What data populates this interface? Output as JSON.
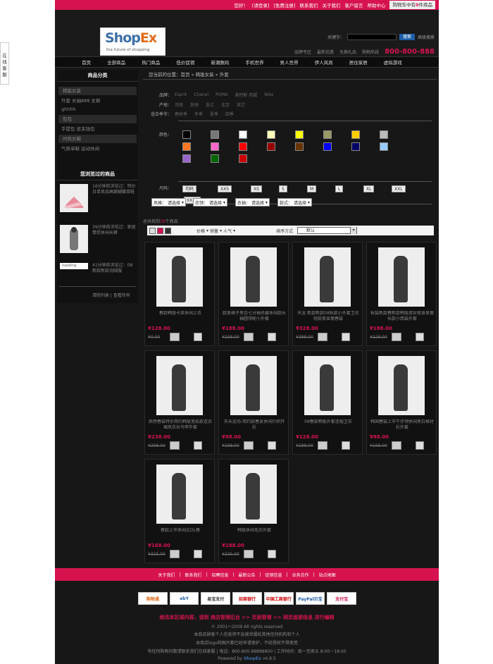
{
  "topbar": {
    "greeting": "您好！",
    "login": "[请登录]",
    "register": "[免费注册]",
    "links": [
      "联系我们",
      "关于我们",
      "客户留言",
      "帮助中心"
    ],
    "cart_prefix": "购物车中有",
    "cart_count": "0",
    "cart_suffix": "件商品"
  },
  "logo": {
    "text_a": "Shop",
    "text_b": "Ex",
    "slogan": "the future of shopping"
  },
  "search": {
    "label": "关键字：",
    "button": "搜索",
    "advanced": "高级搜索"
  },
  "sublinks": {
    "items": [
      "品牌专区",
      "最新优惠",
      "兑换礼品",
      "购物热线"
    ],
    "phone": "800-800-888"
  },
  "nav": [
    "首页",
    "全部商品",
    "热门商品",
    "低价促销",
    "新潮数码",
    "手机世界",
    "男人世界",
    "伊人风尚",
    "居住家居",
    "虚拟游戏"
  ],
  "side_tab": "在线客服",
  "sidebar": {
    "cat_title": "商品分类",
    "cats": [
      "韩版女装",
      "外套  长袖888  女裤",
      "ghhhh",
      "包包",
      "手提包  皮夹钱包",
      "时尚女鞋",
      "气质单鞋  运动休闲"
    ],
    "hist_title": "您浏览过的商品",
    "hist": [
      {
        "text": "16分钟前浏览过：特价日单良品高跟蝴蝶单鞋"
      },
      {
        "text": "39分钟前浏览过：家居情侣休闲长裤"
      },
      {
        "text": "41分钟前浏览过：08新款新款羽绒服",
        "thumb": "loading"
      }
    ],
    "foot": [
      "清除列表",
      "查看所有"
    ]
  },
  "crumb": {
    "prefix": "您当前的位置：",
    "home": "首页",
    "sep": "»",
    "cat": "韩版女装",
    "current": "外套"
  },
  "filters": {
    "brand_label": "品牌：",
    "brands": [
      "Esprit",
      "Chanel",
      "PUMA",
      "美特斯 邦威",
      "Nike"
    ],
    "origin_label": "产地：",
    "origins": [
      "河南",
      "其他",
      "浙江",
      "北京",
      "其它"
    ],
    "season_label": "适合季节：",
    "seasons": [
      "春秋季",
      "冬季",
      "夏季",
      "四季"
    ],
    "color_label": "颜色：",
    "size_label": "尺码：",
    "sizes": [
      "均码",
      "XXS",
      "XS",
      "S",
      "M",
      "L",
      "XL",
      "XXL",
      "XXXL"
    ],
    "selects": [
      {
        "label": "风格：",
        "value": "请选择"
      },
      {
        "label": "衣领：",
        "value": "请选择"
      },
      {
        "label": "衣袖：",
        "value": "请选择"
      },
      {
        "label": "款式：",
        "value": "请选择"
      }
    ]
  },
  "colors": [
    "#000000",
    "#777777",
    "#ffffff",
    "#ffffbb",
    "#ffff00",
    "#999966",
    "#ffcc00",
    "#bbbbbb",
    "#ff7722",
    "#ff66cc",
    "#ff0000",
    "#990000",
    "#663300",
    "#0000ff",
    "#000066",
    "#99ccff",
    "#9966cc",
    "#006600",
    "#cc0000"
  ],
  "result": {
    "prefix": "总共找到",
    "count": "18",
    "suffix": "个商品"
  },
  "sort": {
    "opts": [
      "价格",
      "销量",
      "人气"
    ],
    "label": "排序方式",
    "value": "默认"
  },
  "products": [
    {
      "name": "春款韩版卡其休闲上衣",
      "price": "¥128.00",
      "orig": "¥0.00"
    },
    {
      "name": "欧美格子黑白七分袖名媛休闲款长袖圆领呢小外套",
      "price": "¥188.00",
      "orig": "¥238.00"
    },
    {
      "name": "天龙 新款新款08秋款小外套卫衣短款美显瘦春装",
      "price": "¥328.00",
      "orig": "¥388.00"
    },
    {
      "name": "秋装新款春新款韩版淑女修身显瘦长款小西装外套",
      "price": "¥188.00",
      "orig": "¥228.00"
    },
    {
      "name": "质感春装特价简约韩版宽松款连衣裙风衣长马甲外套",
      "price": "¥238.00",
      "orig": "¥298.00"
    },
    {
      "name": "天长运动-简约款春夏休闲针织开衫",
      "price": "¥98.00",
      "orig": "¥188.00"
    },
    {
      "name": "08春款韩版外套连帽卫衣",
      "price": "¥128.00",
      "orig": "¥188.00"
    },
    {
      "name": "韩国春装上市牛仔领休闲黑白格衬衫外套",
      "price": "¥98.00",
      "orig": "¥168.00"
    },
    {
      "name": "春款上市休闲式OL春",
      "price": "¥168.00",
      "orig": "¥325.00"
    },
    {
      "name": "韩版休闲毛衣外套",
      "price": "¥188.00",
      "orig": "¥235.00"
    }
  ],
  "footer": {
    "nav": [
      "关于我们",
      "联系我们",
      "招聘信息",
      "最新公告",
      "促销信息",
      "业务合作",
      "站点地图"
    ],
    "logos": [
      "购物通",
      "ebY",
      "易宝支付",
      "招商银行",
      "中国工商银行",
      "PayPal贝宝",
      "支付宝"
    ],
    "notice": "修改本区域内容，请到  商店管理后台  >> 页面管理  >> 网页底部信息  进行编辑",
    "copy": "© 2001～2009 All rights reserved",
    "line1": "本商店顾客个人信息将不会被泄漏给其他任何机构和个人",
    "line2": "本商店logo和图片都已经申请保护，不经授权不得使用",
    "line3": "有任何购物问题请联系我们在线客服 | 电话：800-800-88888800 | 工作时间：周一至周五 8:00－18:00",
    "powered_prefix": "Powered by ",
    "powered_brand": "ShopEx",
    "powered_ver": " v4.8.5"
  }
}
